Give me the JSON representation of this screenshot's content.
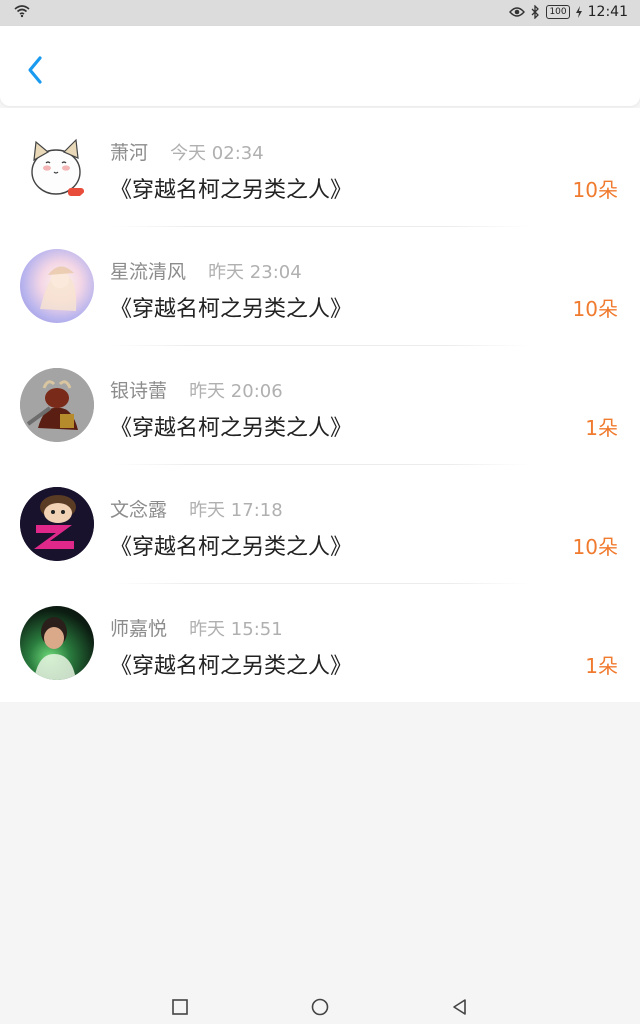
{
  "statusbar": {
    "time": "12:41",
    "battery": "100"
  },
  "header": {
    "back_icon": "chevron-left-icon"
  },
  "items": [
    {
      "name": "萧河",
      "time": "今天 02:34",
      "title": "《穿越名柯之另类之人》",
      "count": "10朵"
    },
    {
      "name": "星流清风",
      "time": "昨天 23:04",
      "title": "《穿越名柯之另类之人》",
      "count": "10朵"
    },
    {
      "name": "银诗蕾",
      "time": "昨天 20:06",
      "title": "《穿越名柯之另类之人》",
      "count": "1朵"
    },
    {
      "name": "文念露",
      "time": "昨天 17:18",
      "title": "《穿越名柯之另类之人》",
      "count": "10朵"
    },
    {
      "name": "师嘉悦",
      "time": "昨天 15:51",
      "title": "《穿越名柯之另类之人》",
      "count": "1朵"
    }
  ],
  "colors": {
    "accent": "#1a9bf0",
    "count": "#f07a2e"
  }
}
